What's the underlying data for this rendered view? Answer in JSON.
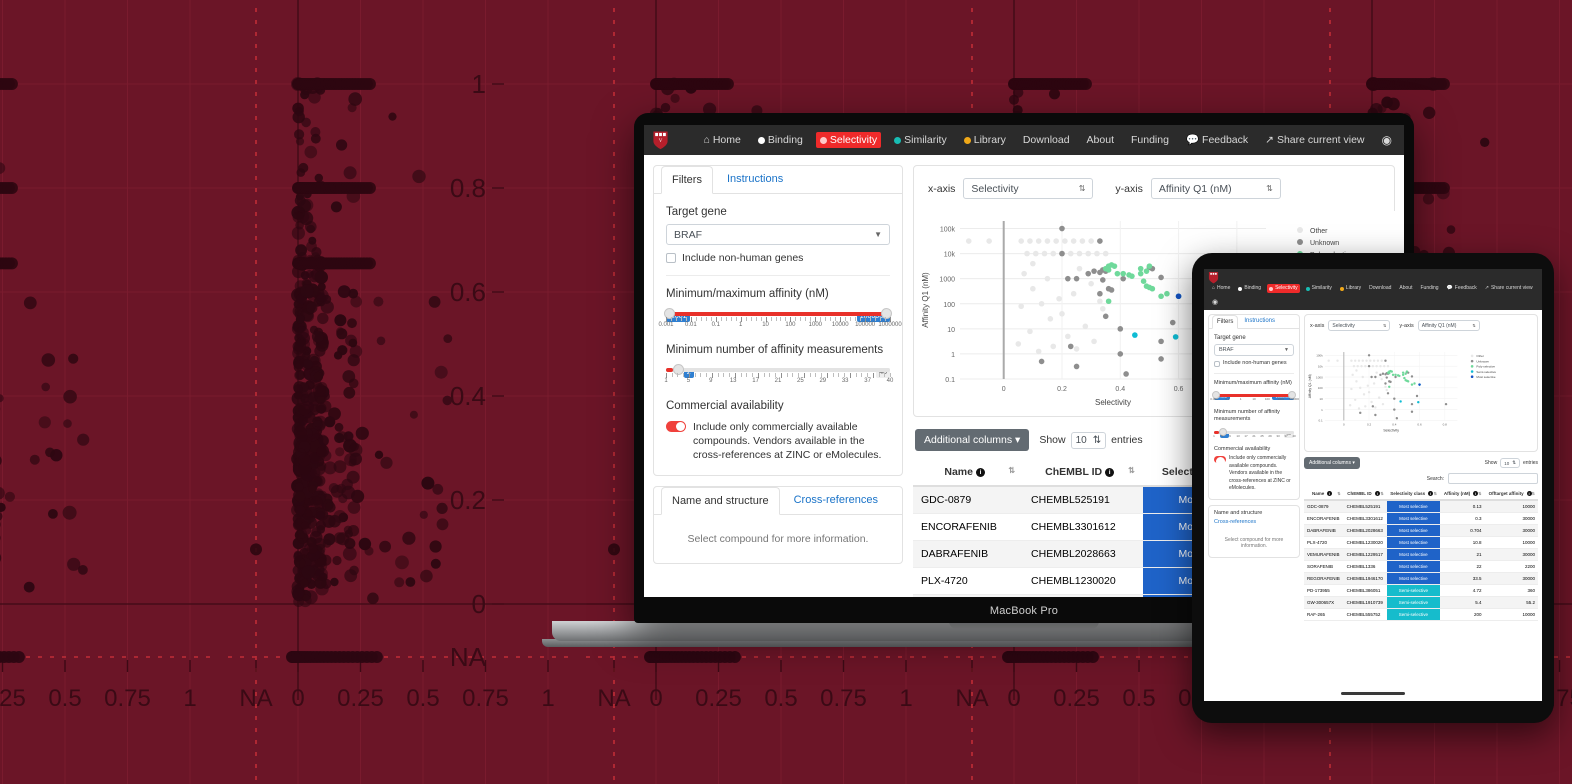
{
  "background_plot": {
    "facet_cols": 4,
    "x_ticks": [
      "NA",
      "0",
      "0.25",
      "0.5",
      "0.75",
      "1"
    ],
    "y_ticks": [
      "NA",
      "0",
      "0.2",
      "0.4",
      "0.6",
      "0.8",
      "1"
    ],
    "bg_color": "#6b1527",
    "point_color": "#2d0711",
    "ref_line_color": "#c02a33"
  },
  "app": {
    "brand_logo": "harvard-shield-icon",
    "nav": [
      {
        "label": "Home",
        "icon": "home-icon",
        "active": false,
        "dot": null
      },
      {
        "label": "Binding",
        "icon": "dot-icon",
        "active": false,
        "dot": "#ffffff"
      },
      {
        "label": "Selectivity",
        "icon": "dot-icon",
        "active": true,
        "dot": "#ffc9c9"
      },
      {
        "label": "Similarity",
        "icon": "dot-icon",
        "active": false,
        "dot": "#18bdb4"
      },
      {
        "label": "Library",
        "icon": "dot-icon",
        "active": false,
        "dot": "#f0a818"
      },
      {
        "label": "Download",
        "icon": null,
        "active": false,
        "dot": null
      },
      {
        "label": "About",
        "icon": null,
        "active": false,
        "dot": null
      },
      {
        "label": "Funding",
        "icon": null,
        "active": false,
        "dot": null
      },
      {
        "label": "Feedback",
        "icon": "chat-icon",
        "active": false,
        "dot": null
      },
      {
        "label": "Share current view",
        "icon": "share-icon",
        "active": false,
        "dot": null
      },
      {
        "label": "",
        "icon": "github-icon",
        "active": false,
        "dot": null
      }
    ],
    "active_nav_color": "#ef2a2a"
  },
  "filters": {
    "tabs": [
      {
        "label": "Filters",
        "selected": true
      },
      {
        "label": "Instructions",
        "selected": false
      }
    ],
    "target_gene": {
      "title": "Target gene",
      "value": "BRAF",
      "checkbox_label": "Include non-human genes",
      "checked": false
    },
    "affinity": {
      "title": "Minimum/maximum affinity (nM)",
      "min_value": "0.001",
      "max_value": "1000000",
      "scale_labels": [
        "0.001",
        "0.01",
        "0.1",
        "1",
        "10",
        "100",
        "1000",
        "10000",
        "100000",
        "1000000"
      ]
    },
    "measurements": {
      "title": "Minimum number of affinity measurements",
      "value": "2",
      "max_value": "40",
      "scale_labels": [
        "1",
        "5",
        "9",
        "13",
        "17",
        "21",
        "25",
        "29",
        "33",
        "37",
        "40"
      ]
    },
    "commercial": {
      "title": "Commercial availability",
      "toggle_on": true,
      "text": "Include only commercially available compounds. Vendors available in the cross-references at ZINC or eMolecules."
    },
    "compound_tabs": [
      {
        "label": "Name and structure",
        "selected": true
      },
      {
        "label": "Cross-references",
        "selected": false
      }
    ],
    "compound_hint": "Select compound for more information."
  },
  "chart_controls": {
    "x_label": "x-axis",
    "x_value": "Selectivity",
    "y_label": "y-axis",
    "y_value": "Affinity Q1 (nM)"
  },
  "chart_data": {
    "type": "scatter",
    "title": "",
    "xlabel": "Selectivity",
    "ylabel": "Affinity Q1 (nM)",
    "x_ticks": [
      "0",
      "0.2",
      "0.4",
      "0.6",
      "0.8"
    ],
    "y_ticks": [
      "0.1",
      "1",
      "10",
      "100",
      "1000",
      "10k",
      "100k"
    ],
    "xlim": [
      -0.15,
      0.9
    ],
    "ylim_log": [
      -1,
      5.3
    ],
    "grid": true,
    "legend_position": "top-right",
    "legend": [
      {
        "name": "Other",
        "color": "#e8e8e8"
      },
      {
        "name": "Unknown",
        "color": "#8e8e8e"
      },
      {
        "name": "Poly-selective",
        "color": "#6fd99b"
      },
      {
        "name": "Semi-selective",
        "color": "#0fbcd4"
      },
      {
        "name": "Most selective",
        "color": "#1552c4"
      }
    ],
    "series": [
      {
        "name": "Other",
        "color": "#e8e8e8",
        "points": [
          [
            -0.12,
            4.5
          ],
          [
            -0.05,
            4.5
          ],
          [
            0.06,
            4.5
          ],
          [
            0.09,
            4.5
          ],
          [
            0.12,
            4.5
          ],
          [
            0.15,
            4.5
          ],
          [
            0.18,
            4.5
          ],
          [
            0.21,
            4.5
          ],
          [
            0.24,
            4.5
          ],
          [
            0.27,
            4.5
          ],
          [
            0.3,
            4.5
          ],
          [
            0.33,
            4.5
          ],
          [
            0.08,
            4.0
          ],
          [
            0.11,
            4.0
          ],
          [
            0.14,
            4.0
          ],
          [
            0.17,
            4.0
          ],
          [
            0.2,
            4.0
          ],
          [
            0.23,
            4.0
          ],
          [
            0.26,
            4.0
          ],
          [
            0.29,
            4.0
          ],
          [
            0.32,
            4.0
          ],
          [
            0.35,
            4.0
          ],
          [
            0.07,
            3.2
          ],
          [
            0.1,
            2.6
          ],
          [
            0.13,
            2.0
          ],
          [
            0.16,
            1.4
          ],
          [
            0.09,
            0.9
          ],
          [
            0.05,
            0.4
          ],
          [
            0.12,
            0.1
          ],
          [
            0.2,
            1.6
          ],
          [
            0.24,
            2.4
          ],
          [
            0.28,
            1.1
          ],
          [
            0.31,
            0.5
          ],
          [
            0.06,
            1.9
          ],
          [
            0.15,
            3.0
          ],
          [
            0.19,
            2.2
          ],
          [
            0.22,
            0.7
          ],
          [
            0.26,
            3.4
          ],
          [
            0.3,
            2.8
          ],
          [
            0.34,
            1.8
          ],
          [
            0.1,
            3.6
          ],
          [
            0.17,
            0.3
          ],
          [
            0.25,
            0.2
          ],
          [
            0.33,
            2.1
          ]
        ]
      },
      {
        "name": "Unknown",
        "color": "#8e8e8e",
        "points": [
          [
            0.2,
            5.0
          ],
          [
            0.33,
            4.5
          ],
          [
            0.25,
            3.0
          ],
          [
            0.29,
            3.2
          ],
          [
            0.31,
            3.3
          ],
          [
            0.34,
            3.35
          ],
          [
            0.35,
            3.3
          ],
          [
            0.36,
            2.6
          ],
          [
            0.37,
            2.55
          ],
          [
            0.33,
            2.4
          ],
          [
            0.41,
            3.0
          ],
          [
            0.5,
            3.45
          ],
          [
            0.51,
            3.4
          ],
          [
            0.54,
            3.05
          ],
          [
            0.35,
            1.5
          ],
          [
            0.4,
            0.0
          ],
          [
            0.4,
            1.0
          ],
          [
            0.42,
            -0.8
          ],
          [
            0.23,
            0.3
          ],
          [
            0.13,
            -0.3
          ],
          [
            0.25,
            -0.5
          ],
          [
            0.54,
            0.5
          ],
          [
            0.54,
            -0.2
          ],
          [
            0.58,
            1.25
          ],
          [
            0.81,
            0.5
          ],
          [
            0.2,
            4.0
          ],
          [
            0.22,
            3.0
          ],
          [
            0.33,
            3.25
          ],
          [
            0.34,
            2.95
          ]
        ]
      },
      {
        "name": "Poly-selective",
        "color": "#6fd99b",
        "points": [
          [
            0.36,
            3.5
          ],
          [
            0.37,
            3.55
          ],
          [
            0.38,
            3.5
          ],
          [
            0.35,
            3.4
          ],
          [
            0.36,
            3.35
          ],
          [
            0.39,
            3.2
          ],
          [
            0.41,
            3.2
          ],
          [
            0.43,
            3.15
          ],
          [
            0.44,
            3.1
          ],
          [
            0.47,
            3.4
          ],
          [
            0.49,
            3.3
          ],
          [
            0.5,
            3.5
          ],
          [
            0.49,
            2.7
          ],
          [
            0.5,
            2.65
          ],
          [
            0.51,
            2.6
          ],
          [
            0.54,
            2.3
          ],
          [
            0.56,
            2.4
          ],
          [
            0.36,
            2.1
          ],
          [
            0.47,
            3.2
          ],
          [
            0.48,
            2.9
          ]
        ]
      },
      {
        "name": "Semi-selective",
        "color": "#0fbcd4",
        "points": [
          [
            0.45,
            0.75
          ],
          [
            0.59,
            0.68
          ],
          [
            0.6,
            2.3
          ]
        ]
      },
      {
        "name": "Most selective",
        "color": "#1552c4",
        "points": [
          [
            0.6,
            2.3
          ]
        ]
      }
    ]
  },
  "table_controls": {
    "additional_columns": "Additional columns",
    "show_label": "Show",
    "entries_label": "entries",
    "page_size": "10",
    "search_label": "Search:",
    "search_value": ""
  },
  "table": {
    "columns": [
      {
        "label": "Name",
        "info": true,
        "sortable": true
      },
      {
        "label": "ChEMBL ID",
        "info": true,
        "sortable": true
      },
      {
        "label": "Selectivity class",
        "info": true,
        "sortable": true
      },
      {
        "label": "Affinity (nM)",
        "info": true,
        "sortable": true
      },
      {
        "label": "Offtarget affinity",
        "info": true,
        "sortable": true
      }
    ],
    "rows": [
      {
        "name": "GDC-0879",
        "chembl": "CHEMBL525191",
        "cls": "Most selective",
        "cls_color": "#1f63c8",
        "affinity": "0.13",
        "offtarget": "10000"
      },
      {
        "name": "ENCORAFENIB",
        "chembl": "CHEMBL3301612",
        "cls": "Most selective",
        "cls_color": "#1f63c8",
        "affinity": "0.3",
        "offtarget": "30000"
      },
      {
        "name": "DABRAFENIB",
        "chembl": "CHEMBL2028663",
        "cls": "Most selective",
        "cls_color": "#1f63c8",
        "affinity": "0.704",
        "offtarget": "30000"
      },
      {
        "name": "PLX-4720",
        "chembl": "CHEMBL1230020",
        "cls": "Most selective",
        "cls_color": "#1f63c8",
        "affinity": "10.8",
        "offtarget": "10000"
      },
      {
        "name": "VEMURAFENIB",
        "chembl": "CHEMBL1229517",
        "cls": "Most selective",
        "cls_color": "#1f63c8",
        "affinity": "21",
        "offtarget": "30000"
      },
      {
        "name": "SORAFENIB",
        "chembl": "CHEMBL1336",
        "cls": "Most selective",
        "cls_color": "#1f63c8",
        "affinity": "22",
        "offtarget": "2200"
      },
      {
        "name": "REGORAFENIB",
        "chembl": "CHEMBL1946170",
        "cls": "Most selective",
        "cls_color": "#1f63c8",
        "affinity": "33.5",
        "offtarget": "30000"
      },
      {
        "name": "PD-173955",
        "chembl": "CHEMBL386051",
        "cls": "Semi-selective",
        "cls_color": "#16bccc",
        "affinity": "4.72",
        "offtarget": "360"
      },
      {
        "name": "GW-300657X",
        "chembl": "CHEMBL1910739",
        "cls": "Semi-selective",
        "cls_color": "#16bccc",
        "affinity": "5.4",
        "offtarget": "55.2"
      },
      {
        "name": "RAF-265",
        "chembl": "CHEMBL555752",
        "cls": "Semi-selective",
        "cls_color": "#16bccc",
        "affinity": "200",
        "offtarget": "10000"
      }
    ]
  },
  "devices": {
    "laptop_label": "MacBook Pro"
  }
}
